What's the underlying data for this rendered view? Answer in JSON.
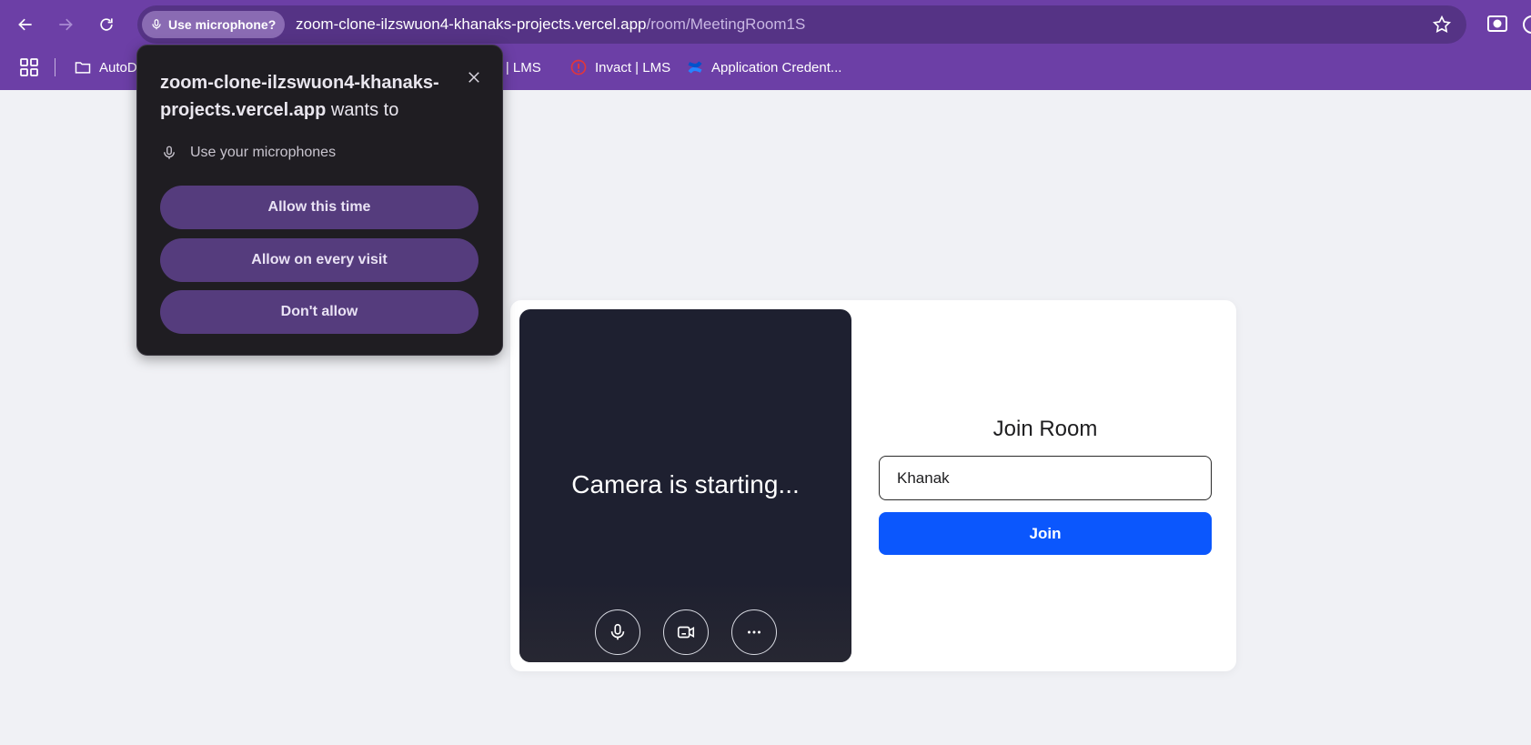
{
  "browser": {
    "permission_chip": "Use microphone?",
    "url_host": "zoom-clone-ilzswuon4-khanaks-projects.vercel.app",
    "url_path": "/room/MeetingRoom1S",
    "bookmarks": [
      {
        "label": "AutoD",
        "icon": "folder-icon"
      },
      {
        "label": "ct | LMS",
        "icon": "none"
      },
      {
        "label": "Invact | LMS",
        "icon": "invact-logo-icon"
      },
      {
        "label": "Application Credent...",
        "icon": "confluence-logo-icon"
      }
    ]
  },
  "popup": {
    "site": "zoom-clone-ilzswuon4-khanaks-projects.vercel.app",
    "suffix": " wants to",
    "permission": "Use your microphones",
    "buttons": {
      "allow_once": "Allow this time",
      "allow_always": "Allow on every visit",
      "deny": "Don't allow"
    }
  },
  "preview": {
    "status": "Camera is starting..."
  },
  "join": {
    "title": "Join Room",
    "name_value": "Khanak",
    "button": "Join"
  },
  "colors": {
    "chrome": "#6c3fa6",
    "omnibox": "#553385",
    "popup_bg": "#1f1d22",
    "popup_button": "#553c7d",
    "video_bg": "#1e2030",
    "join_button": "#0b57fd",
    "page_bg": "#f0f1f5"
  }
}
